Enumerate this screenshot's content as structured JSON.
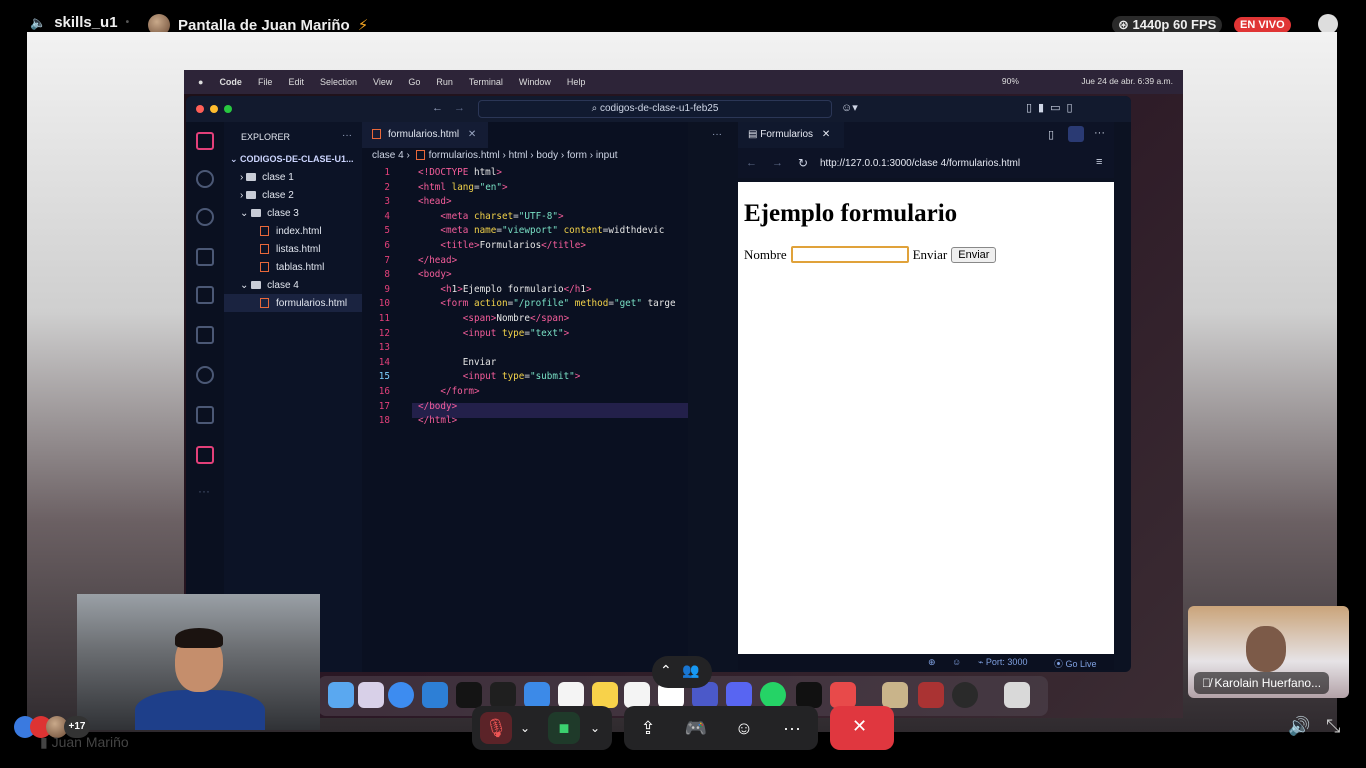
{
  "topbar": {
    "channel": "skills_u1",
    "screen_title": "Pantalla de Juan Mariño",
    "quality": "1440p 60 FPS",
    "live_badge": "EN VIVO"
  },
  "mac_menu": {
    "app": "Code",
    "items": [
      "File",
      "Edit",
      "Selection",
      "View",
      "Go",
      "Run",
      "Terminal",
      "Window",
      "Help"
    ],
    "battery": "90%",
    "clock": "Jue 24 de abr.  6:39 a.m."
  },
  "vscode": {
    "command_center": "codigos-de-clase-u1-feb25",
    "explorer": {
      "title": "EXPLORER",
      "root": "CODIGOS-DE-CLASE-U1...",
      "items": [
        {
          "label": "clase 1"
        },
        {
          "label": "clase 2"
        },
        {
          "label": "clase 3"
        },
        {
          "label": "index.html"
        },
        {
          "label": "listas.html"
        },
        {
          "label": "tablas.html"
        },
        {
          "label": "clase 4"
        },
        {
          "label": "formularios.html"
        }
      ]
    },
    "editor": {
      "tab": "formularios.html",
      "breadcrumb": [
        "clase 4",
        "formularios.html",
        "html",
        "body",
        "form",
        "input"
      ],
      "line_numbers": [
        "1",
        "2",
        "3",
        "4",
        "5",
        "6",
        "7",
        "8",
        "9",
        "10",
        "11",
        "12",
        "13",
        "14",
        "15",
        "16",
        "17",
        "18"
      ],
      "lines": [
        "<!DOCTYPE html>",
        "<html lang=\"en\">",
        "<head>",
        "    <meta charset=\"UTF-8\">",
        "    <meta name=\"viewport\" content=\"width=devic",
        "    <title>Formularios</title>",
        "</head>",
        "<body>",
        "    <h1>Ejemplo formulario</h1>",
        "    <form action=\"/profile\" method=\"get\" targe",
        "        <span>Nombre</span>",
        "        <input type=\"text\">",
        "",
        "        Enviar",
        "        <input type=\"submit\">",
        "    </form>",
        "</body>",
        "</html>"
      ]
    },
    "preview": {
      "tab": "Formularios",
      "url": "http://127.0.0.1:3000/clase 4/formularios.html",
      "heading": "Ejemplo formulario",
      "label": "Nombre",
      "text_after": "Enviar",
      "button": "Enviar"
    },
    "status": {
      "port": "Port: 3000",
      "golive": "Go Live"
    }
  },
  "webcam": {
    "name": "Juan Mariño"
  },
  "participants": {
    "count_more": "+17",
    "tile_name": "Karolain Huerfano..."
  },
  "colors": {
    "live": "#e03535",
    "end_call": "#e0373f",
    "vscode_bg": "#0c1222",
    "accent_pink": "#f45d9a"
  }
}
